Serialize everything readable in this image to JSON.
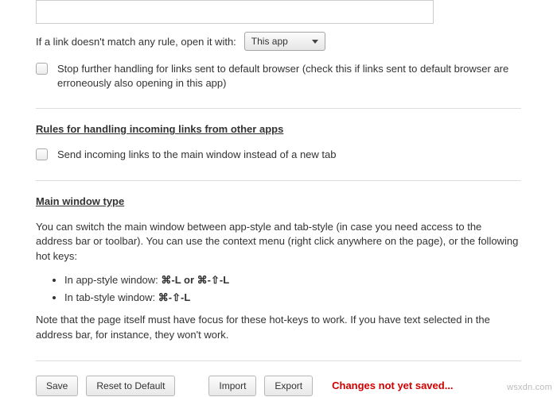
{
  "default_rule": {
    "label": "If a link doesn't match any rule, open it with:",
    "selected": "This app"
  },
  "stop_further": {
    "label": "Stop further handling for links sent to default browser (check this if links sent to default browser are erroneously also opening in this app)"
  },
  "incoming": {
    "heading": "Rules for handling incoming links from other apps",
    "send_main_label": "Send incoming links to the main window instead of a new tab"
  },
  "main_window": {
    "heading": "Main window type",
    "intro": "You can switch the main window between app-style and tab-style (in case you need access to the address bar or toolbar). You can use the context menu (right click anywhere on the page), or the following hot keys:",
    "hotkeys": [
      {
        "prefix": "In app-style window: ",
        "keys": "⌘-L or ⌘-⇧-L"
      },
      {
        "prefix": "In tab-style window: ",
        "keys": "⌘-⇧-L"
      }
    ],
    "note": "Note that the page itself must have focus for these hot-keys to work. If you have text selected in the address bar, for instance, they won't work."
  },
  "footer": {
    "save": "Save",
    "reset": "Reset to Default",
    "import": "Import",
    "export": "Export",
    "status": "Changes not yet saved..."
  },
  "watermark": "wsxdn.com"
}
